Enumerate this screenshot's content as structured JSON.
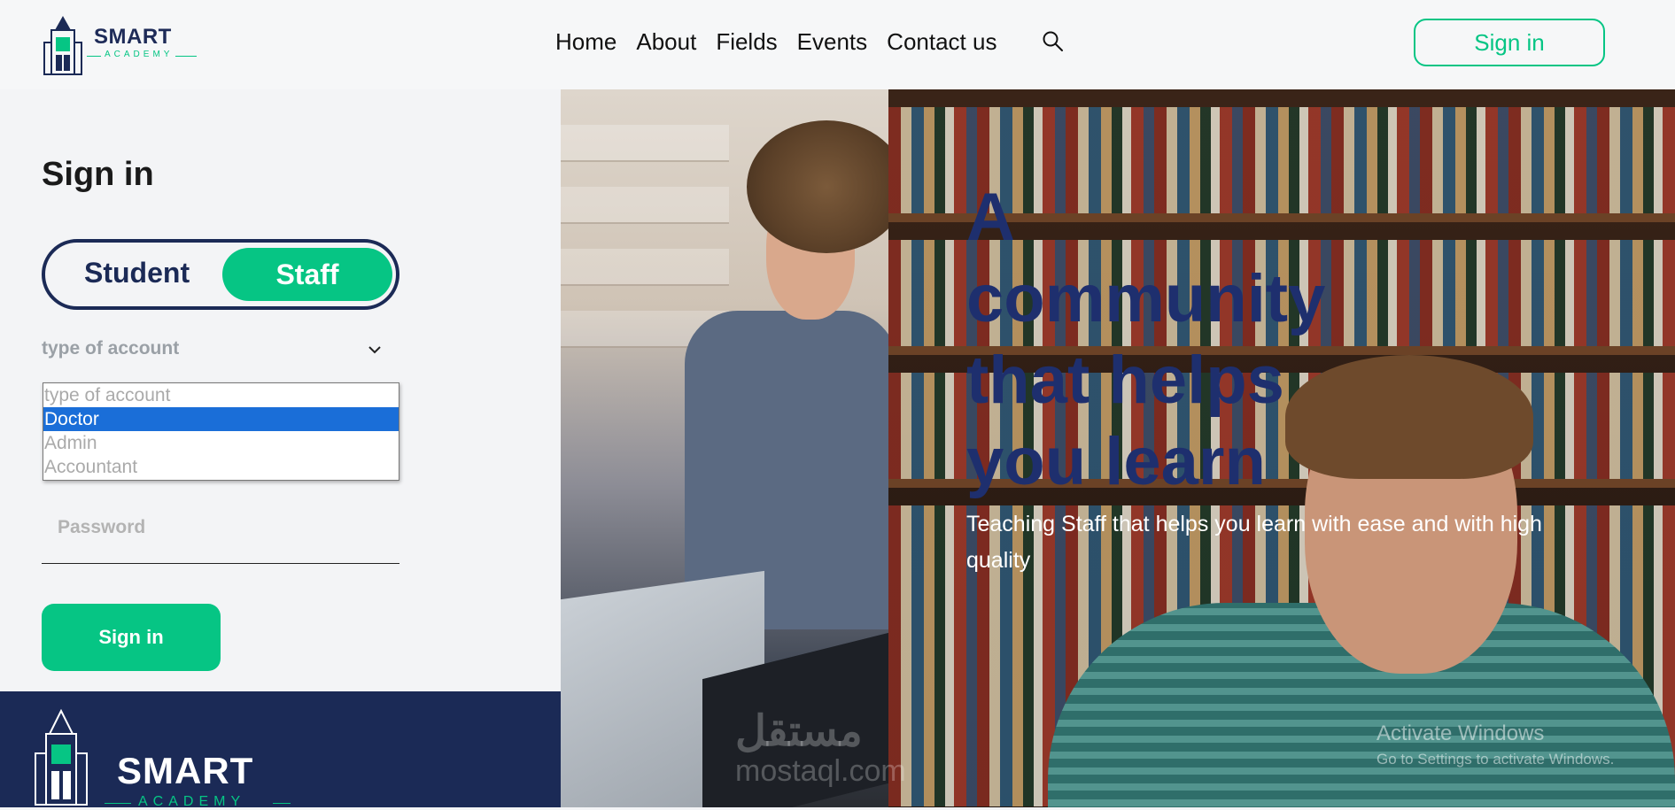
{
  "header": {
    "logo": {
      "word": "SMART",
      "sub": "ACADEMY"
    },
    "nav": [
      "Home",
      "About",
      "Fields",
      "Events",
      "Contact us"
    ],
    "search_icon": "search-icon",
    "signin_label": "Sign in"
  },
  "form": {
    "title": "Sign in",
    "toggle": {
      "student": "Student",
      "staff": "Staff",
      "selected": "Staff"
    },
    "account_type_placeholder": "type of account",
    "dropdown_options": [
      "type of account",
      "Doctor",
      "Admin",
      "Accountant"
    ],
    "dropdown_selected": "Doctor",
    "password_placeholder": "Password",
    "submit_label": "Sign in"
  },
  "footer": {
    "logo": {
      "word": "SMART",
      "sub": "ACADEMY"
    }
  },
  "hero": {
    "title": "A community that helps you learn",
    "subtitle": "Teaching Staff that helps you learn with ease and with high quality"
  },
  "watermark": {
    "logo_text": "مستقل",
    "url": "mostaql.com"
  },
  "os_overlay": {
    "title": "Activate Windows",
    "subtitle": "Go to Settings to activate Windows."
  },
  "colors": {
    "primary": "#06c584",
    "navy": "#1b2a56",
    "hero_title": "#1e2f6e",
    "dropdown_selection": "#1a6ed8"
  }
}
